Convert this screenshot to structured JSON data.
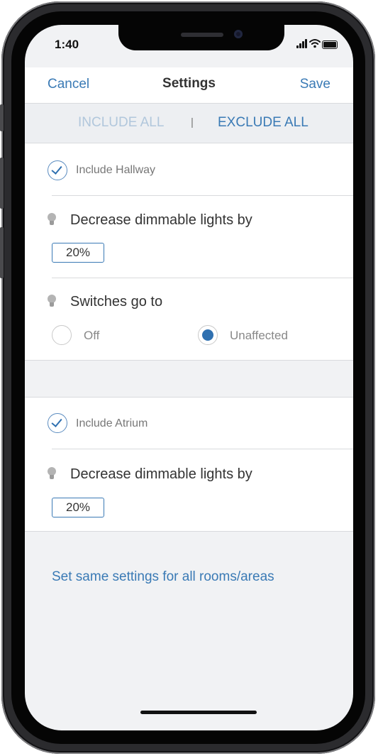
{
  "status": {
    "time": "1:40"
  },
  "nav": {
    "cancel": "Cancel",
    "title": "Settings",
    "save": "Save"
  },
  "filter": {
    "include_all": "INCLUDE ALL",
    "separator": "|",
    "exclude_all": "EXCLUDE ALL"
  },
  "rooms": [
    {
      "include_label": "Include Hallway",
      "dim_label": "Decrease dimmable lights by",
      "dim_value": "20%",
      "switch_label": "Switches go to",
      "switch_options": [
        {
          "label": "Off",
          "selected": false
        },
        {
          "label": "Unaffected",
          "selected": true
        }
      ]
    },
    {
      "include_label": "Include Atrium",
      "dim_label": "Decrease dimmable lights by",
      "dim_value": "20%"
    }
  ],
  "bottom_link": "Set same settings for all rooms/areas",
  "colors": {
    "accent": "#3a7ab5",
    "accent_light": "#b1c7dc",
    "background": "#f1f2f4"
  }
}
